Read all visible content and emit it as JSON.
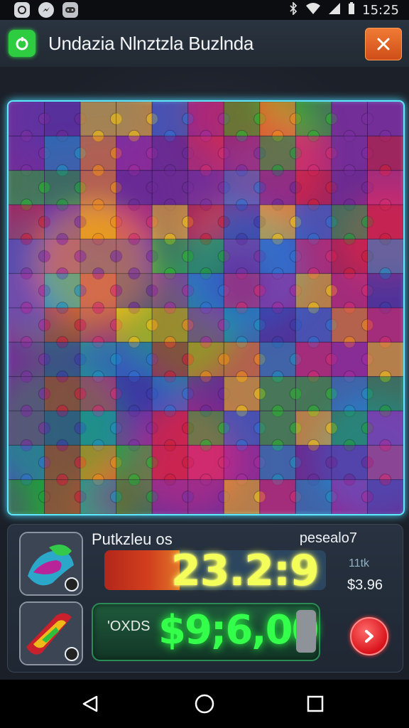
{
  "status_bar": {
    "time": "15:25",
    "left_icons": [
      "app-notification-icon",
      "messenger-icon",
      "gamepad-icon"
    ],
    "right_icons": [
      "bluetooth-icon",
      "wifi-icon",
      "signal-icon",
      "battery-icon"
    ]
  },
  "header": {
    "title": "Undazia Nlnztzla Buzlnda",
    "app_icon": "app-logo-icon",
    "close_icon": "close-icon",
    "accent": "#e8622a"
  },
  "puzzle": {
    "rows": 12,
    "cols": 11,
    "palette": [
      "#7b2fa0",
      "#6a2a96",
      "#2bb12f",
      "#1e9e3c",
      "#c81f3a",
      "#d12c6e",
      "#1f8fc0",
      "#2f6fd0",
      "#f2c117",
      "#f08a1c",
      "#a32c9e",
      "#3a3aa6"
    ]
  },
  "hud": {
    "left_label": "Putkzleu os",
    "right_label": "pesealo7",
    "timer": "23.2:9",
    "progress": 0.34,
    "side_sub": "11tk",
    "side_price": "$3.96",
    "money_label": "'OXDS",
    "money_value": "$9;6,00",
    "next_icon": "arrow-right-icon"
  },
  "nav": {
    "icons": [
      "back-icon",
      "home-icon",
      "recents-icon"
    ]
  }
}
